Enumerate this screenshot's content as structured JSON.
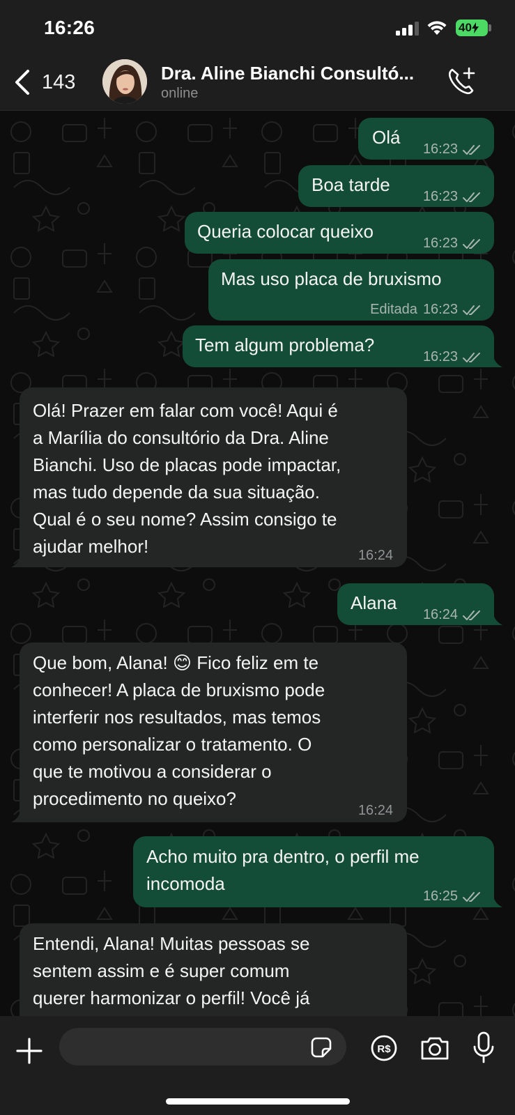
{
  "status_bar": {
    "time": "16:26",
    "battery": "40"
  },
  "header": {
    "back_count": "143",
    "contact_name": "Dra. Aline Bianchi Consultó...",
    "contact_status": "online"
  },
  "messages": [
    {
      "dir": "out",
      "text": "Olá",
      "time": "16:23",
      "read": true
    },
    {
      "dir": "out",
      "text": "Boa tarde",
      "time": "16:23",
      "read": true
    },
    {
      "dir": "out",
      "text": "Queria colocar queixo",
      "time": "16:23",
      "read": true
    },
    {
      "dir": "out",
      "text": "Mas uso placa de bruxismo",
      "edited": "Editada",
      "time": "16:23",
      "read": true
    },
    {
      "dir": "out",
      "text": "Tem algum problema?",
      "time": "16:23",
      "read": true
    },
    {
      "dir": "in",
      "lines": [
        "Olá! Prazer em falar com você! Aqui é",
        "a Marília do consultório da Dra. Aline",
        "Bianchi. Uso de placas pode impactar,",
        "mas tudo depende da sua situação.",
        "Qual é o seu nome? Assim consigo te",
        "ajudar melhor!"
      ],
      "time": "16:24"
    },
    {
      "dir": "out",
      "text": "Alana",
      "time": "16:24",
      "read": true
    },
    {
      "dir": "in",
      "lines": [
        "Que bom, Alana! 😊 Fico feliz em te",
        "conhecer! A placa de bruxismo pode",
        "interferir nos resultados, mas temos",
        "como personalizar o tratamento. O",
        "que te motivou a considerar o",
        "procedimento no queixo?"
      ],
      "time": "16:24"
    },
    {
      "dir": "out",
      "lines": [
        "Acho muito pra dentro, o perfil me",
        "incomoda"
      ],
      "time": "16:25",
      "read": true
    },
    {
      "dir": "in",
      "lines": [
        "Entendi, Alana! Muitas pessoas se",
        "sentem assim e é super comum",
        "querer harmonizar o perfil! Você já"
      ]
    }
  ],
  "composer": {
    "placeholder": ""
  },
  "colors": {
    "outgoing": "#144d37",
    "incoming": "#242626",
    "background": "#0d0d0d",
    "battery": "#4cd964"
  },
  "icons": [
    "back-chevron-icon",
    "add-call-icon",
    "plus-icon",
    "sticker-icon",
    "pix-payment-icon",
    "camera-icon",
    "microphone-icon"
  ]
}
